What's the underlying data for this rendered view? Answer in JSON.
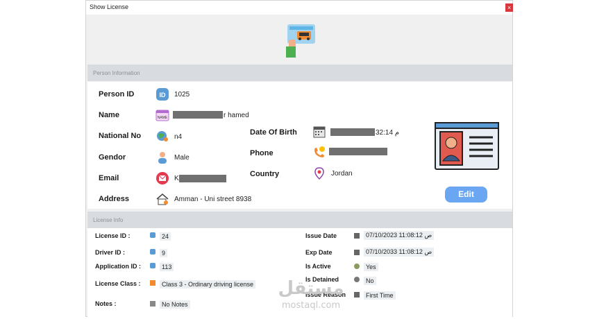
{
  "window": {
    "title": "Show License",
    "close": "×"
  },
  "person_section": {
    "title": "Person Information"
  },
  "person": {
    "id_label": "Person ID",
    "id_value": "1025",
    "name_label": "Name",
    "name_value": "r hamed",
    "national_label": "National No",
    "national_value": "n4",
    "gender_label": "Gendor",
    "gender_value": "Male",
    "email_label": "Email",
    "email_value": "K",
    "address_label": "Address",
    "address_value": "Amman - Uni street 8938",
    "dob_label": "Date Of Birth",
    "dob_value": "32:14 م",
    "phone_label": "Phone",
    "phone_value": "",
    "country_label": "Country",
    "country_value": "Jordan",
    "id_badge": "ID",
    "name_badge": "NAME"
  },
  "edit_button": "Edit",
  "license_section": {
    "title": "License Info"
  },
  "license": {
    "license_id_label": "License ID :",
    "license_id_value": "24",
    "driver_id_label": "Driver ID :",
    "driver_id_value": "9",
    "app_id_label": "Application ID :",
    "app_id_value": "113",
    "class_label": "License Class :",
    "class_value": "Class 3 - Ordinary driving license",
    "notes_label": "Notes :",
    "notes_value": "No Notes",
    "issue_date_label": "Issue Date",
    "issue_date_value": "07/10/2023 11:08:12 ص",
    "exp_date_label": "Exp Date",
    "exp_date_value": "07/10/2033 11:08:12 ص",
    "active_label": "Is Active",
    "active_value": "Yes",
    "detained_label": "Is Detained",
    "detained_value": "No",
    "reason_label": "Issue Reason",
    "reason_value": "First Time"
  },
  "watermark": {
    "arabic": "مستقل",
    "latin": "mostaql.com"
  },
  "colors": {
    "accent": "#6aa6f2",
    "band": "#d8dce0",
    "close": "#d9363e"
  }
}
